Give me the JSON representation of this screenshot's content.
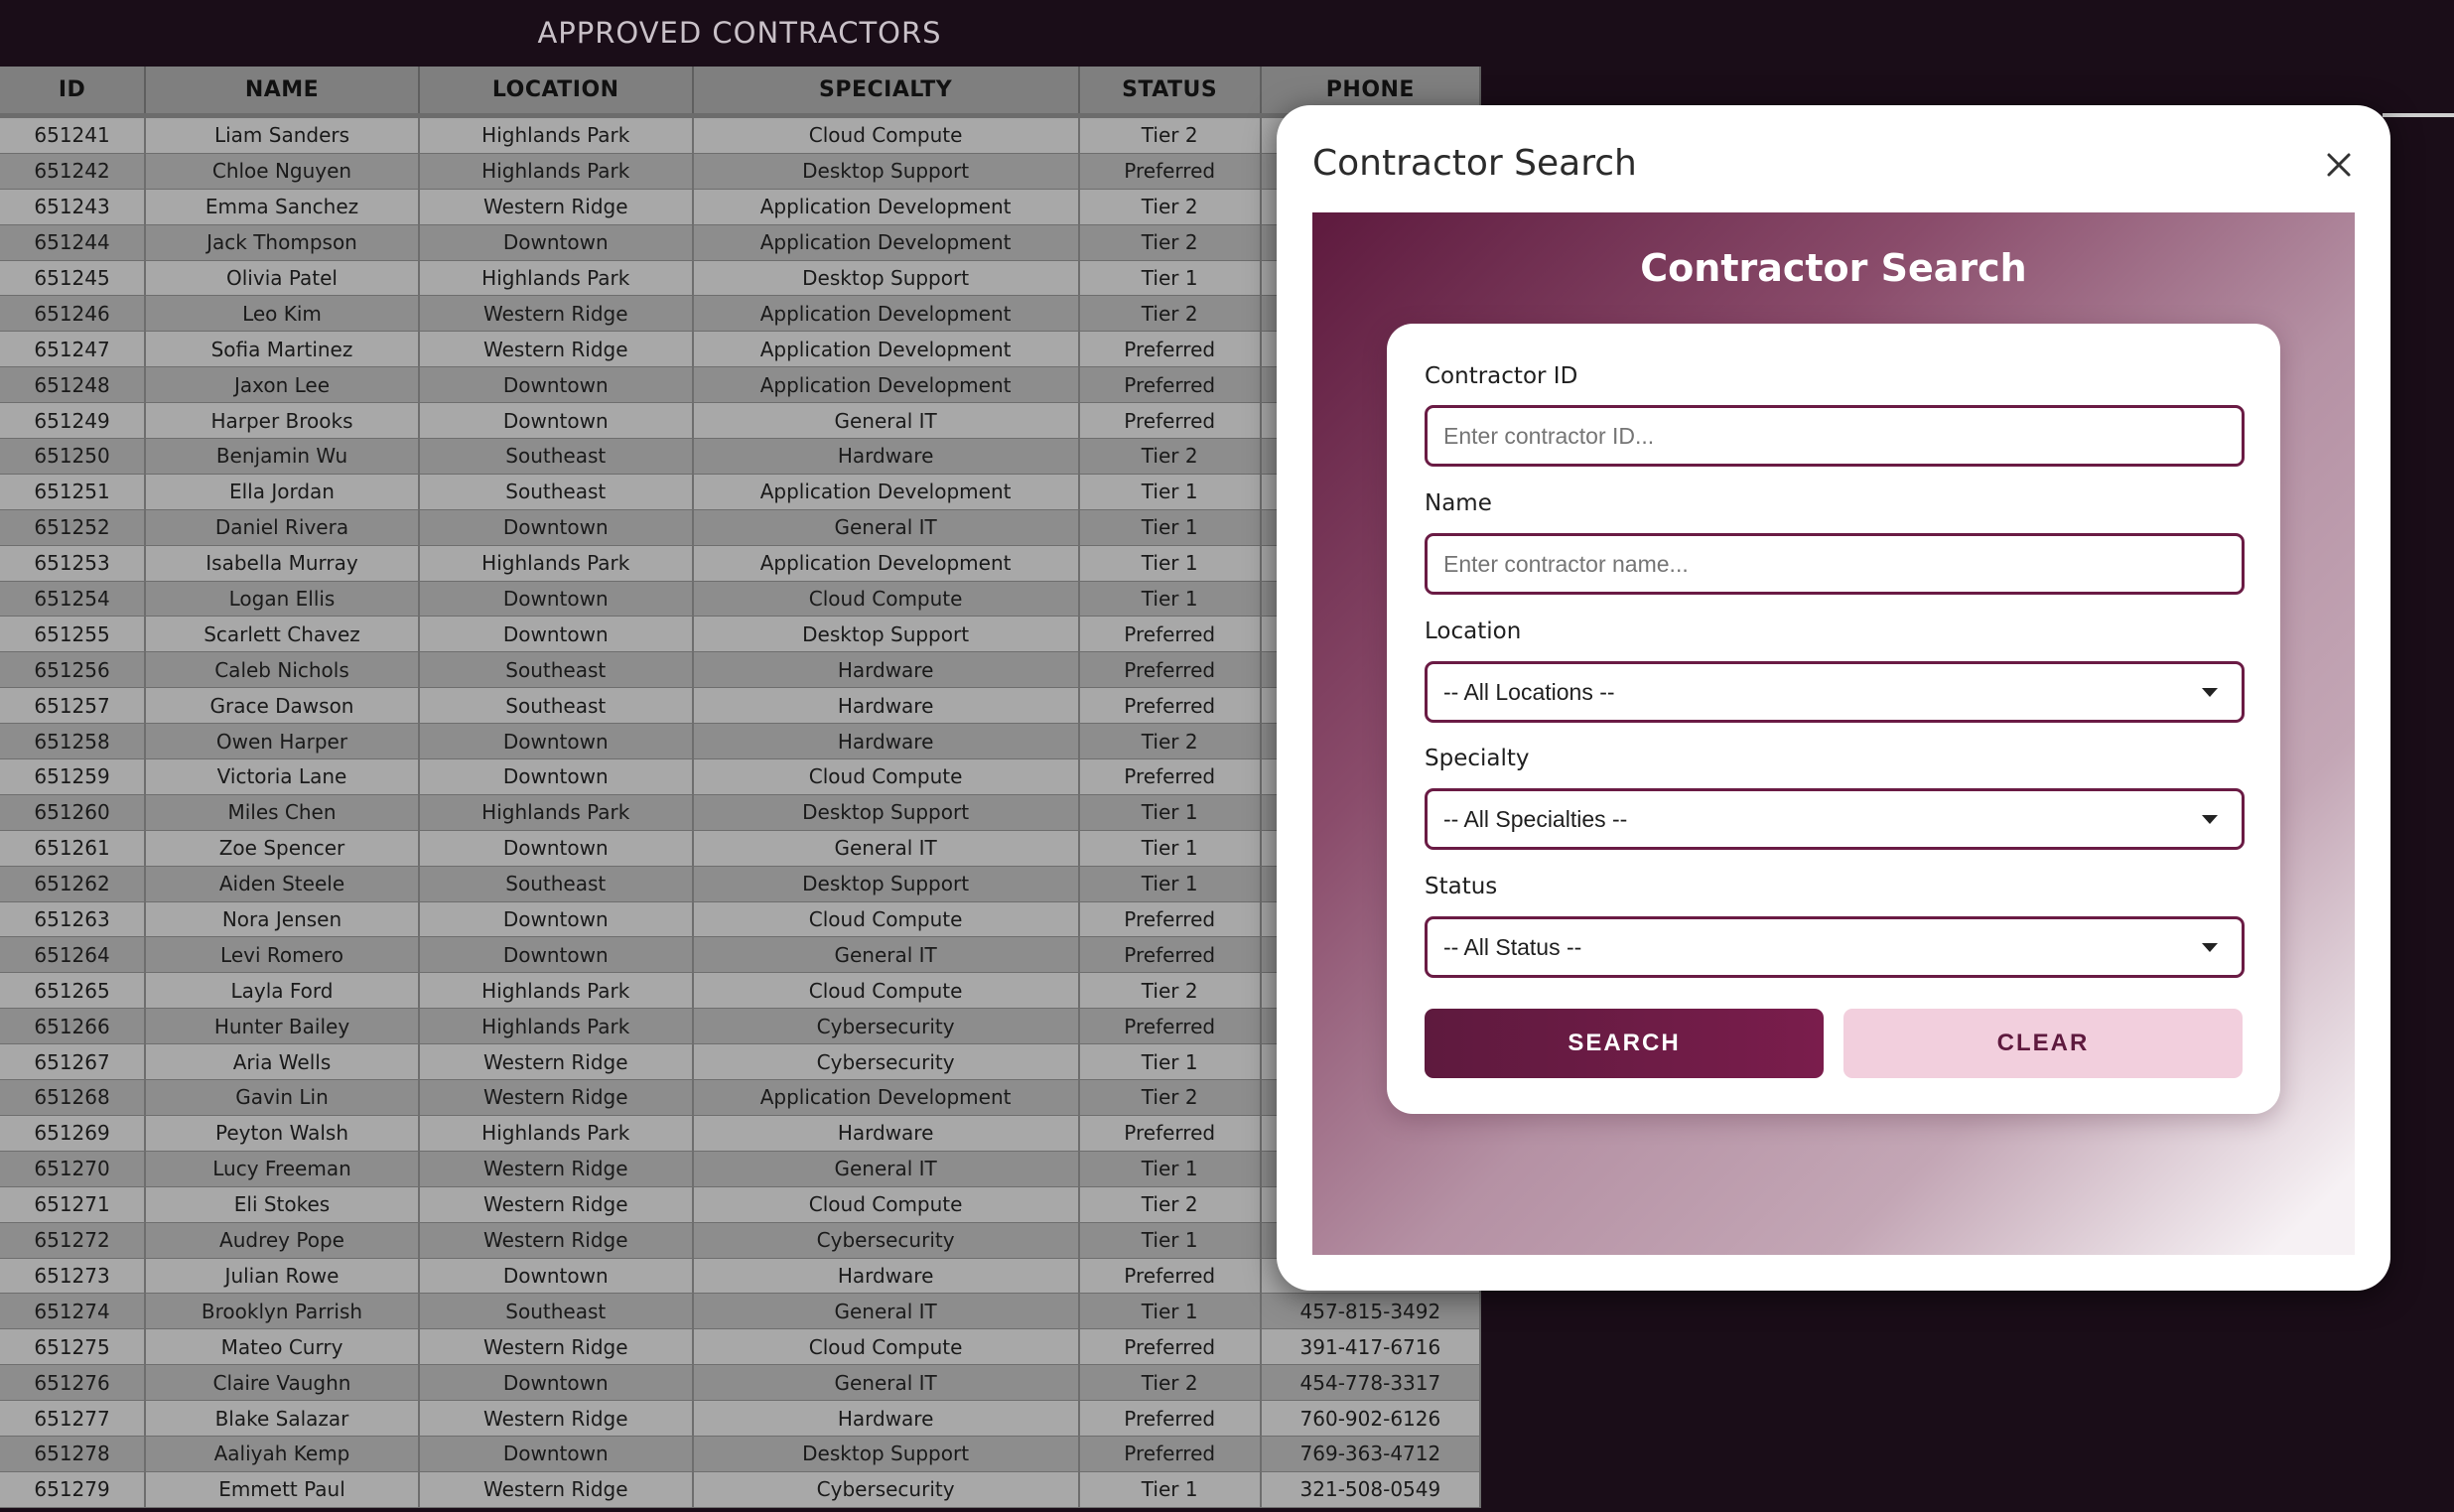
{
  "sheet": {
    "title": "APPROVED CONTRACTORS",
    "columns": [
      "ID",
      "NAME",
      "LOCATION",
      "SPECIALTY",
      "STATUS",
      "PHONE"
    ],
    "rows": [
      [
        "651241",
        "Liam Sanders",
        "Highlands Park",
        "Cloud Compute",
        "Tier 2",
        ""
      ],
      [
        "651242",
        "Chloe Nguyen",
        "Highlands Park",
        "Desktop Support",
        "Preferred",
        ""
      ],
      [
        "651243",
        "Emma Sanchez",
        "Western Ridge",
        "Application Development",
        "Tier 2",
        ""
      ],
      [
        "651244",
        "Jack Thompson",
        "Downtown",
        "Application Development",
        "Tier 2",
        ""
      ],
      [
        "651245",
        "Olivia Patel",
        "Highlands Park",
        "Desktop Support",
        "Tier 1",
        ""
      ],
      [
        "651246",
        "Leo Kim",
        "Western Ridge",
        "Application Development",
        "Tier 2",
        ""
      ],
      [
        "651247",
        "Sofia Martinez",
        "Western Ridge",
        "Application Development",
        "Preferred",
        ""
      ],
      [
        "651248",
        "Jaxon Lee",
        "Downtown",
        "Application Development",
        "Preferred",
        ""
      ],
      [
        "651249",
        "Harper Brooks",
        "Downtown",
        "General IT",
        "Preferred",
        ""
      ],
      [
        "651250",
        "Benjamin Wu",
        "Southeast",
        "Hardware",
        "Tier 2",
        ""
      ],
      [
        "651251",
        "Ella Jordan",
        "Southeast",
        "Application Development",
        "Tier 1",
        ""
      ],
      [
        "651252",
        "Daniel Rivera",
        "Downtown",
        "General IT",
        "Tier 1",
        ""
      ],
      [
        "651253",
        "Isabella Murray",
        "Highlands Park",
        "Application Development",
        "Tier 1",
        ""
      ],
      [
        "651254",
        "Logan Ellis",
        "Downtown",
        "Cloud Compute",
        "Tier 1",
        ""
      ],
      [
        "651255",
        "Scarlett Chavez",
        "Downtown",
        "Desktop Support",
        "Preferred",
        ""
      ],
      [
        "651256",
        "Caleb Nichols",
        "Southeast",
        "Hardware",
        "Preferred",
        ""
      ],
      [
        "651257",
        "Grace Dawson",
        "Southeast",
        "Hardware",
        "Preferred",
        ""
      ],
      [
        "651258",
        "Owen Harper",
        "Downtown",
        "Hardware",
        "Tier 2",
        ""
      ],
      [
        "651259",
        "Victoria Lane",
        "Downtown",
        "Cloud Compute",
        "Preferred",
        ""
      ],
      [
        "651260",
        "Miles Chen",
        "Highlands Park",
        "Desktop Support",
        "Tier 1",
        ""
      ],
      [
        "651261",
        "Zoe Spencer",
        "Downtown",
        "General IT",
        "Tier 1",
        ""
      ],
      [
        "651262",
        "Aiden Steele",
        "Southeast",
        "Desktop Support",
        "Tier 1",
        ""
      ],
      [
        "651263",
        "Nora Jensen",
        "Downtown",
        "Cloud Compute",
        "Preferred",
        ""
      ],
      [
        "651264",
        "Levi Romero",
        "Downtown",
        "General IT",
        "Preferred",
        ""
      ],
      [
        "651265",
        "Layla Ford",
        "Highlands Park",
        "Cloud Compute",
        "Tier 2",
        ""
      ],
      [
        "651266",
        "Hunter Bailey",
        "Highlands Park",
        "Cybersecurity",
        "Preferred",
        ""
      ],
      [
        "651267",
        "Aria Wells",
        "Western Ridge",
        "Cybersecurity",
        "Tier 1",
        ""
      ],
      [
        "651268",
        "Gavin Lin",
        "Western Ridge",
        "Application Development",
        "Tier 2",
        ""
      ],
      [
        "651269",
        "Peyton Walsh",
        "Highlands Park",
        "Hardware",
        "Preferred",
        ""
      ],
      [
        "651270",
        "Lucy Freeman",
        "Western Ridge",
        "General IT",
        "Tier 1",
        ""
      ],
      [
        "651271",
        "Eli Stokes",
        "Western Ridge",
        "Cloud Compute",
        "Tier 2",
        ""
      ],
      [
        "651272",
        "Audrey Pope",
        "Western Ridge",
        "Cybersecurity",
        "Tier 1",
        ""
      ],
      [
        "651273",
        "Julian Rowe",
        "Downtown",
        "Hardware",
        "Preferred",
        ""
      ],
      [
        "651274",
        "Brooklyn Parrish",
        "Southeast",
        "General IT",
        "Tier 1",
        "457-815-3492"
      ],
      [
        "651275",
        "Mateo Curry",
        "Western Ridge",
        "Cloud Compute",
        "Preferred",
        "391-417-6716"
      ],
      [
        "651276",
        "Claire Vaughn",
        "Downtown",
        "General IT",
        "Tier 2",
        "454-778-3317"
      ],
      [
        "651277",
        "Blake Salazar",
        "Western Ridge",
        "Hardware",
        "Preferred",
        "760-902-6126"
      ],
      [
        "651278",
        "Aaliyah Kemp",
        "Downtown",
        "Desktop Support",
        "Preferred",
        "769-363-4712"
      ],
      [
        "651279",
        "Emmett Paul",
        "Western Ridge",
        "Cybersecurity",
        "Tier 1",
        "321-508-0549"
      ]
    ]
  },
  "modal": {
    "title": "Contractor Search",
    "close_icon": "close-icon",
    "panel_title": "Contractor Search",
    "fields": {
      "contractor_id": {
        "label": "Contractor ID",
        "placeholder": "Enter contractor ID...",
        "value": ""
      },
      "name": {
        "label": "Name",
        "placeholder": "Enter contractor name...",
        "value": ""
      },
      "location": {
        "label": "Location",
        "selected": "-- All Locations --"
      },
      "specialty": {
        "label": "Specialty",
        "selected": "-- All Specialties --"
      },
      "status": {
        "label": "Status",
        "selected": "-- All Status --"
      }
    },
    "buttons": {
      "search": "SEARCH",
      "clear": "CLEAR"
    }
  },
  "colors": {
    "page_background": "#1a0d18",
    "accent": "#6a1b44",
    "button_primary": "#5e1a3e",
    "button_secondary": "#f2cfdd"
  }
}
